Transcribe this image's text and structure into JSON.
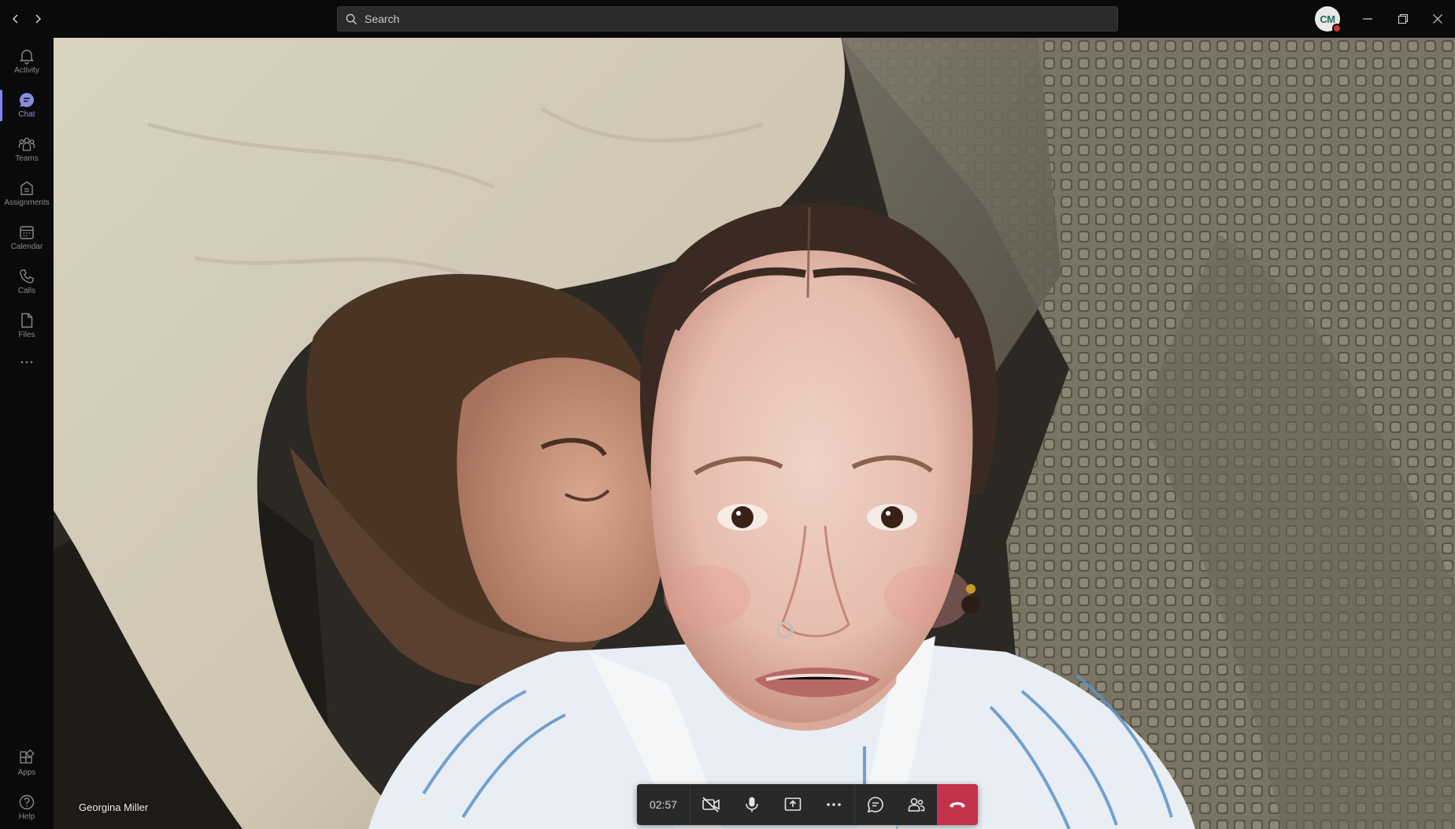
{
  "titlebar": {
    "back_icon": "chevron-left-icon",
    "forward_icon": "chevron-right-icon",
    "search": {
      "placeholder": "Search",
      "icon": "search-icon"
    },
    "avatar": {
      "initials": "CM",
      "presence_color": "#d13438"
    },
    "window_controls": [
      "minimize-icon",
      "restore-icon",
      "close-icon"
    ]
  },
  "rail": {
    "items": [
      {
        "label": "Activity",
        "icon": "bell-icon"
      },
      {
        "label": "Chat",
        "icon": "chat-icon",
        "active": true
      },
      {
        "label": "Teams",
        "icon": "teams-icon"
      },
      {
        "label": "Assignments",
        "icon": "assignments-icon"
      },
      {
        "label": "Calendar",
        "icon": "calendar-icon"
      },
      {
        "label": "Calls",
        "icon": "phone-icon"
      },
      {
        "label": "Files",
        "icon": "file-icon"
      },
      {
        "label": "",
        "icon": "more-horizontal-icon"
      }
    ],
    "bottom_items": [
      {
        "label": "Apps",
        "icon": "apps-icon"
      },
      {
        "label": "Help",
        "icon": "help-icon"
      }
    ],
    "accent_color": "#7f85f5"
  },
  "call": {
    "participant_name": "Georgina Miller",
    "timer": "02:57",
    "controls": [
      {
        "name": "camera-off",
        "icon": "camera-off-icon"
      },
      {
        "name": "microphone",
        "icon": "microphone-icon"
      },
      {
        "name": "share-screen",
        "icon": "share-screen-icon"
      },
      {
        "name": "more-actions",
        "icon": "more-horizontal-icon"
      },
      {
        "name": "chat",
        "icon": "chat-bubble-icon"
      },
      {
        "name": "participants",
        "icon": "people-icon"
      },
      {
        "name": "hang-up",
        "icon": "phone-hangup-icon"
      }
    ],
    "hangup_color": "#c4314b"
  }
}
